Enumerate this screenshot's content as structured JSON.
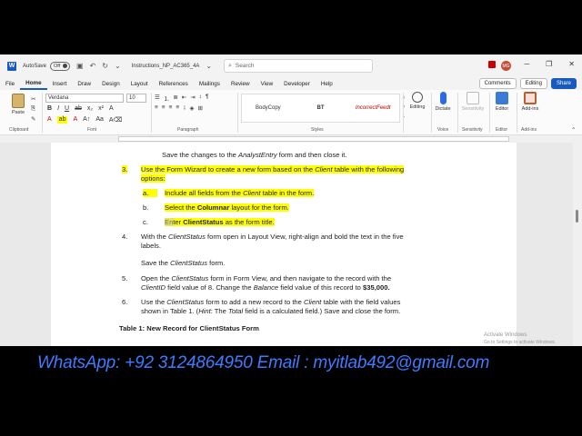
{
  "titlebar": {
    "autosave_label": "AutoSave",
    "autosave_state": "Off",
    "doc_title": "Instructions_NP_AC365_4A",
    "search_placeholder": "Search",
    "avatar_initials": "MG"
  },
  "menu": {
    "tabs": [
      "File",
      "Home",
      "Insert",
      "Draw",
      "Design",
      "Layout",
      "References",
      "Mailings",
      "Review",
      "View",
      "Developer",
      "Help"
    ],
    "comments_label": "Comments",
    "editing_label": "Editing",
    "share_label": "Share"
  },
  "ribbon": {
    "paste_label": "Paste",
    "font_name": "Verdana",
    "font_size": "10",
    "style_1": "BodyCopy",
    "style_2": "BT",
    "style_3": "IncorrectFeedt",
    "editing_label": "Editing",
    "dictate_label": "Dictate",
    "sensitivity_label": "Sensitivity",
    "editor_label": "Editor",
    "addins_label": "Add-ins",
    "groups": {
      "clipboard": "Clipboard",
      "font": "Font",
      "paragraph": "Paragraph",
      "styles": "Styles",
      "voice": "Voice",
      "sensitivity": "Sensitivity",
      "editor": "Editor",
      "addins": "Add-ins"
    }
  },
  "document": {
    "line0": {
      "a": "Save the changes to the ",
      "b": "AnalystEntry",
      "c": " form and then close it."
    },
    "step3": {
      "num": "3.",
      "l1a": "Use the Form Wizard to create a new form based on the ",
      "l1b": "Client",
      "l1c": " table with the following",
      "l2": "options:"
    },
    "sub_a": {
      "num": "a.",
      "a": "Include all fields from the ",
      "b": "Client",
      "c": " table in the form."
    },
    "sub_b": {
      "num": "b.",
      "a": "Select the ",
      "b": "Columnar",
      "c": " layout for the form."
    },
    "sub_c": {
      "num": "c.",
      "a": "Enter ",
      "b": "ClientStatus",
      "c": " as the form title."
    },
    "step4": {
      "num": "4.",
      "l1a": "With the ",
      "l1b": "ClientStatus",
      "l1c": " form open in Layout View, right-align and bold the text in the five",
      "l2": "labels.",
      "l3a": "Save the ",
      "l3b": "ClientStatus",
      "l3c": " form."
    },
    "step5": {
      "num": "5.",
      "l1a": "Open the ",
      "l1b": "ClientStatus",
      "l1c": " form in Form View, and then navigate to the record with the",
      "l2a": "ClientID",
      "l2b": " field value of 8. Change the ",
      "l2c": "Balance",
      "l2d": " field value of this record to ",
      "l2e": "$35,000."
    },
    "step6": {
      "num": "6.",
      "l1a": "Use the ",
      "l1b": "ClientStatus",
      "l1c": " form to add a new record to the ",
      "l1d": "Client",
      "l1e": " table with the field values",
      "l2a": "shown in Table 1. (",
      "l2b": "Hint",
      "l2c": ": The ",
      "l2d": "Total",
      "l2e": " field is a calculated field.) Save and close the form."
    },
    "table_caption": "Table 1: New Record for ClientStatus Form",
    "activate_line1": "Activate Windows",
    "activate_line2": "Go to Settings to activate Windows."
  },
  "banner": {
    "text": "WhatsApp: +92 3124864950    Email : myitlab492@gmail.com"
  },
  "colors": {
    "word_blue": "#185abd",
    "highlight": "#ffff00",
    "banner_text": "#3d7bff"
  }
}
